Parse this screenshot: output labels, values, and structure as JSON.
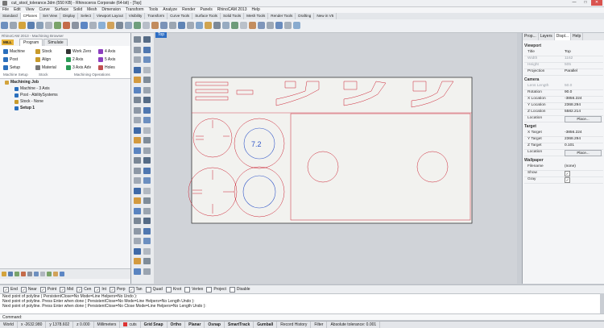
{
  "window": {
    "title": "cut_stool_tolerance.3dm (550 KB) - Rhinoceros Corporate (64-bit) - [Top]",
    "btn_min": "—",
    "btn_max": "□",
    "btn_close": "✕"
  },
  "menu": [
    "File",
    "Edit",
    "View",
    "Curve",
    "Surface",
    "Solid",
    "Mesh",
    "Dimension",
    "Transform",
    "Tools",
    "Analyze",
    "Render",
    "Panels",
    "RhinoCAM 2013",
    "Help"
  ],
  "toolbar_tabs": [
    {
      "label": "Standard"
    },
    {
      "label": "CPlanes",
      "active": true
    },
    {
      "label": "Set View"
    },
    {
      "label": "Display"
    },
    {
      "label": "Select"
    },
    {
      "label": "Viewport Layout"
    },
    {
      "label": "Visibility"
    },
    {
      "label": "Transform"
    },
    {
      "label": "Curve Tools"
    },
    {
      "label": "Surface Tools"
    },
    {
      "label": "Solid Tools"
    },
    {
      "label": "Mesh Tools"
    },
    {
      "label": "Render Tools"
    },
    {
      "label": "Drafting"
    },
    {
      "label": "New in V5"
    }
  ],
  "browser": {
    "title": "RhinoCAM 2013 - Machining Browser",
    "mill_label": "MILL",
    "tabs": [
      {
        "label": "Program",
        "active": true
      },
      {
        "label": "Simulate"
      }
    ],
    "ribbon": [
      {
        "label": "Machine",
        "color": "#2a6fbd"
      },
      {
        "label": "Stock",
        "color": "#c89a2a"
      },
      {
        "label": "Work Zero",
        "color": "#333333"
      },
      {
        "label": "4 Axis",
        "color": "#8c3fbf"
      },
      {
        "label": "Post",
        "color": "#2a6fbd"
      },
      {
        "label": "Align",
        "color": "#c89a2a"
      },
      {
        "label": "2 Axis",
        "color": "#2a9a55"
      },
      {
        "label": "5 Axis",
        "color": "#8c3fbf"
      },
      {
        "label": "Setup",
        "color": "#2a6fbd"
      },
      {
        "label": "Material",
        "color": "#777777"
      },
      {
        "label": "3 Axis Adv",
        "color": "#2a9a55"
      },
      {
        "label": "Holes",
        "color": "#c05050"
      }
    ],
    "groups": [
      "Machine Setup",
      "Stock",
      "Machining Operations"
    ],
    "tree": [
      {
        "label": "Machining Job",
        "bold": true
      },
      {
        "label": "Machine - 3 Axis"
      },
      {
        "label": "Post - AbilitySystems"
      },
      {
        "label": "Stock - None"
      },
      {
        "label": "Setup 1",
        "bold": true
      }
    ]
  },
  "viewport": {
    "label": "Top",
    "part_text": "7.2"
  },
  "properties": {
    "tabs": [
      {
        "label": "Prop..."
      },
      {
        "label": "Layers"
      },
      {
        "label": "Displ...",
        "active": true
      },
      {
        "label": "Help"
      }
    ],
    "viewport_header": "Viewport",
    "viewport_rows": [
      {
        "key": "Title",
        "value": "Top"
      },
      {
        "key": "Width",
        "value": "1162",
        "dim": true
      },
      {
        "key": "Height",
        "value": "505",
        "dim": true
      },
      {
        "key": "Projection",
        "value": "Parallel"
      }
    ],
    "camera_header": "Camera",
    "camera_rows": [
      {
        "key": "Lens Length",
        "value": "50.0",
        "dim": true
      },
      {
        "key": "Rotation",
        "value": "90.0"
      },
      {
        "key": "X Location",
        "value": "-3856.224"
      },
      {
        "key": "Y Location",
        "value": "2368.294"
      },
      {
        "key": "Z Location",
        "value": "5582.214"
      },
      {
        "key": "Location",
        "value": ""
      }
    ],
    "target_header": "Target",
    "target_rows": [
      {
        "key": "X Target",
        "value": "-3856.224"
      },
      {
        "key": "Y Target",
        "value": "2368.294"
      },
      {
        "key": "Z Target",
        "value": "0.101"
      },
      {
        "key": "Location",
        "value": ""
      }
    ],
    "place_label": "Place...",
    "wallpaper_header": "Wallpaper",
    "wallpaper_rows": [
      {
        "key": "Filename",
        "value": "(none)"
      },
      {
        "key": "Show",
        "value": "✓"
      },
      {
        "key": "Gray",
        "value": "✓"
      }
    ]
  },
  "osnap": [
    {
      "label": "End",
      "checked": true
    },
    {
      "label": "Near",
      "checked": true
    },
    {
      "label": "Point",
      "checked": true
    },
    {
      "label": "Mid",
      "checked": true
    },
    {
      "label": "Cen",
      "checked": true
    },
    {
      "label": "Int",
      "checked": true
    },
    {
      "label": "Perp",
      "checked": true
    },
    {
      "label": "Tan",
      "checked": true
    },
    {
      "label": "Quad",
      "checked": false
    },
    {
      "label": "Knot",
      "checked": false
    },
    {
      "label": "Vertex",
      "checked": false
    },
    {
      "label": "Project",
      "checked": false
    },
    {
      "label": "Disable",
      "checked": false
    }
  ],
  "command_history": [
    "Next point of polyline ( PersistentClose=No  Mode=Line  Helpers=No  Undo ):",
    "Next point of polyline. Press Enter when done ( PersistentClose=No  Mode=Line  Helpers=No  Length  Undo ):",
    "Next point of polyline. Press Enter when done ( PersistentClose=No  Close  Mode=Line  Helpers=No  Length  Undo ):"
  ],
  "command_prompt": "Command:",
  "status": {
    "cplane": "World",
    "x": "x -2632.980",
    "y": "y 1378.602",
    "z": "z 0.000",
    "units": "Millimeters",
    "layer": "cuts",
    "grid_snap": "Grid Snap",
    "ortho": "Ortho",
    "planar": "Planar",
    "osnap": "Osnap",
    "smarttrack": "SmartTrack",
    "gumball": "Gumball",
    "record_history": "Record History",
    "filter": "Filter",
    "tolerance": "Absolute tolerance: 0.001"
  }
}
